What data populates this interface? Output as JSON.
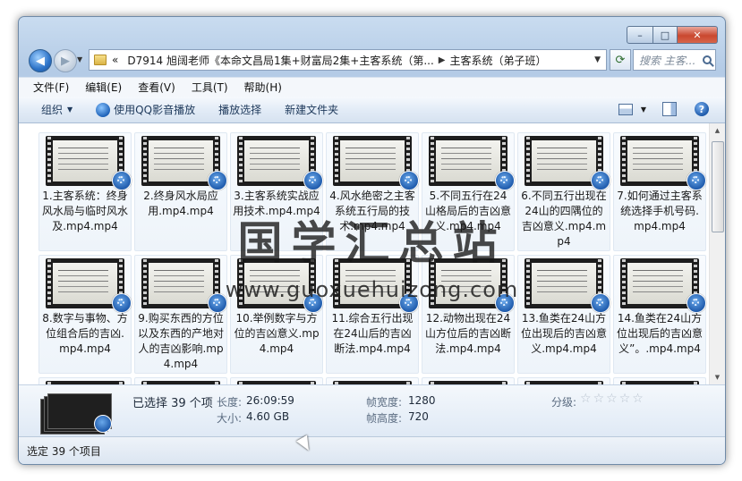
{
  "window": {
    "buttons": {
      "minimize": "–",
      "maximize": "□",
      "close": "✕"
    }
  },
  "nav": {
    "back_glyph": "◀",
    "forward_glyph": "▶",
    "address_prefix": "«",
    "address_path": [
      "D7914 旭阔老师《本命文昌局1集+财富局2集+主客系统（第...",
      "主客系统（弟子班）"
    ],
    "search_placeholder": "搜索 主客..."
  },
  "menu": [
    "文件(F)",
    "编辑(E)",
    "查看(V)",
    "工具(T)",
    "帮助(H)"
  ],
  "toolbar": {
    "organize": "组织",
    "play_with": "使用QQ影音播放",
    "play_selection": "播放选择",
    "new_folder": "新建文件夹",
    "help": "?"
  },
  "files": [
    "1.主客系统：终身风水局与临时风水及.mp4.mp4",
    "2.终身风水局应用.mp4.mp4",
    "3.主客系统实战应用技术.mp4.mp4",
    "4.风水绝密之主客系统五行局的技术.mp4.mp4",
    "5.不同五行在24山格局后的吉凶意义.mp4.mp4",
    "6.不同五行出现在24山的四隅位的吉凶意义.mp4.mp4",
    "7.如何通过主客系统选择手机号码.mp4.mp4",
    "8.数字与事物、方位组合后的吉凶.mp4.mp4",
    "9.购买东西的方位以及东西的产地对人的吉凶影响.mp4.mp4",
    "10.举例数字与方位的吉凶意义.mp4.mp4",
    "11.综合五行出现在24山后的吉凶断法.mp4.mp4",
    "12.动物出现在24山方位后的吉凶断法.mp4.mp4",
    "13.鱼类在24山方位出现后的吉凶意义.mp4.mp4",
    "14.鱼类在24山方位出现后的吉凶意义”。.mp4.mp4"
  ],
  "watermark": {
    "title": "国学汇总站",
    "url": "www.guoxuehuizong.com"
  },
  "details": {
    "selected": "已选择 39 个项",
    "length_label": "长度:",
    "length": "26:09:59",
    "size_label": "大小:",
    "size": "4.60 GB",
    "frame_width_label": "帧宽度:",
    "frame_width": "1280",
    "frame_height_label": "帧高度:",
    "frame_height": "720",
    "rating_label": "分级:",
    "rating_stars": [
      "☆",
      "☆",
      "☆",
      "☆",
      "☆"
    ]
  },
  "status": {
    "text": "选定 39 个项目"
  },
  "colors": {
    "accent": "#1a56a8",
    "frame": "#b4cbe6"
  }
}
